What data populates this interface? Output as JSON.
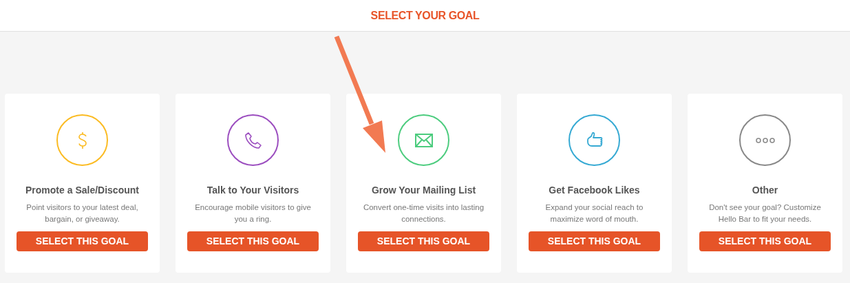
{
  "header": {
    "title": "SELECT YOUR GOAL"
  },
  "goals": [
    {
      "kind": "dollar",
      "color": "#fbbb22",
      "title": "Promote a Sale/Discount",
      "description": "Point visitors to your latest deal, bargain, or giveaway.",
      "button": "SELECT THIS GOAL"
    },
    {
      "kind": "phone",
      "color": "#9b4dbf",
      "title": "Talk to Your Visitors",
      "description": "Encourage mobile visitors to give you a ring.",
      "button": "SELECT THIS GOAL"
    },
    {
      "kind": "mail",
      "color": "#4ccc7e",
      "title": "Grow Your Mailing List",
      "description": "Convert one-time visits into lasting connections.",
      "button": "SELECT THIS GOAL"
    },
    {
      "kind": "thumb",
      "color": "#35a9d3",
      "title": "Get Facebook Likes",
      "description": "Expand your social reach to maximize word of mouth.",
      "button": "SELECT THIS GOAL"
    },
    {
      "kind": "dots",
      "color": "#888888",
      "title": "Other",
      "description": "Don't see your goal? Customize Hello Bar to fit your needs.",
      "button": "SELECT THIS GOAL"
    }
  ]
}
